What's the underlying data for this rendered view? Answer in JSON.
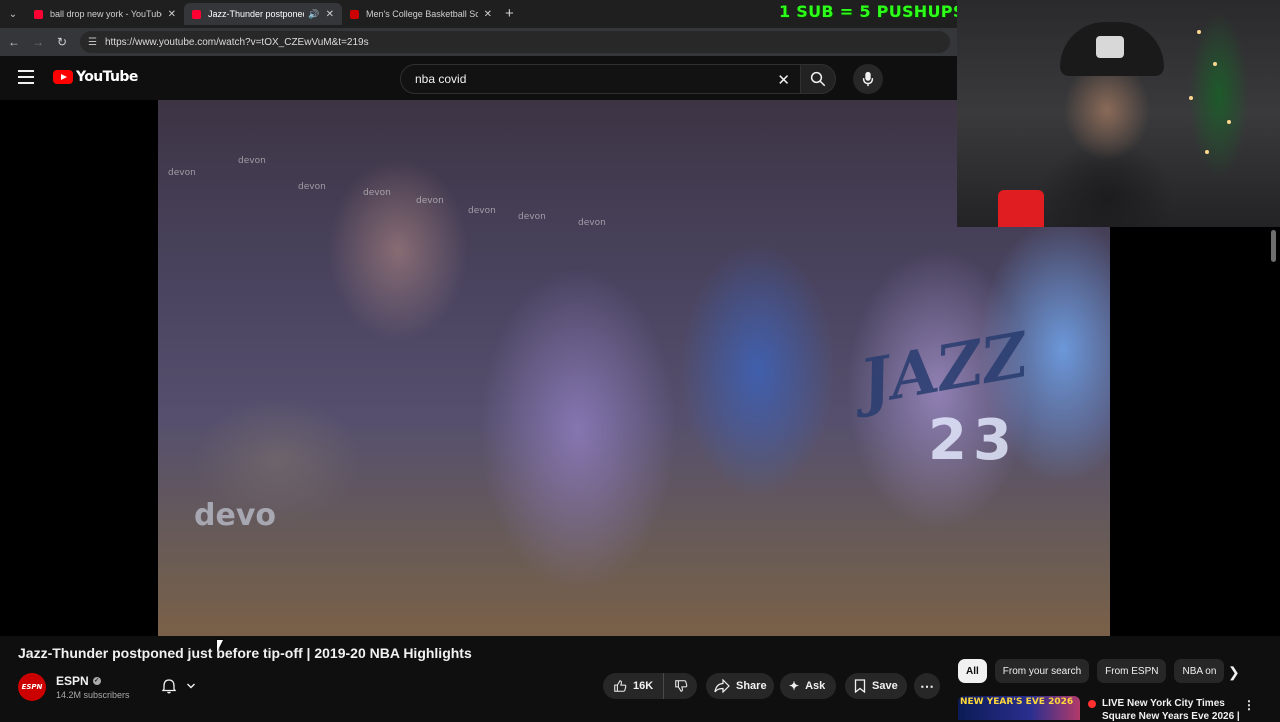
{
  "browser": {
    "tabs": [
      {
        "title": "ball drop new york - YouTube",
        "favicon_color": "#ff0033"
      },
      {
        "title": "Jazz-Thunder postponed ju",
        "favicon_color": "#ff0033"
      },
      {
        "title": "Men's College Basketball Sched",
        "favicon_color": "#cc0000"
      }
    ],
    "url": "https://www.youtube.com/watch?v=tOX_CZEwVuM&t=219s"
  },
  "overlay": {
    "banner_text": "1 SUB = 5 PUSHUPS",
    "banner_color": "#2cff1a"
  },
  "header": {
    "logo_text": "YouTube",
    "search_query": "nba covid"
  },
  "video": {
    "jersey_text": "JAZZ",
    "jersey_number": "23",
    "courtside_ad": "devo",
    "watermarks": [
      "devon",
      "devon",
      "devon",
      "devon",
      "devon",
      "devon",
      "devon",
      "devon"
    ]
  },
  "watch": {
    "title": "Jazz-Thunder postponed just before tip-off | 2019-20 NBA Highlights",
    "channel_name": "ESPN",
    "channel_avatar_text": "ESPN",
    "subscribers": "14.2M subscribers",
    "likes": "16K",
    "share_label": "Share",
    "ask_label": "Ask",
    "save_label": "Save"
  },
  "sidebar": {
    "chips": [
      "All",
      "From your search",
      "From ESPN",
      "NBA on"
    ],
    "recommendation": {
      "thumb_text": "NEW YEAR'S EVE 2026",
      "title_line1": "LIVE New York City Times",
      "title_line2": "Square New Years Eve 2026 |"
    }
  }
}
